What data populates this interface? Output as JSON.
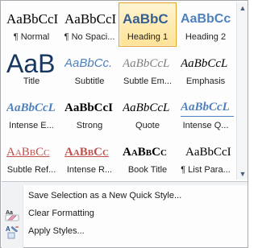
{
  "gallery": {
    "styles": [
      {
        "preview": "AaBbCcI",
        "label": "¶ Normal",
        "selected": false
      },
      {
        "preview": "AaBbCcI",
        "label": "¶ No Spaci...",
        "selected": false
      },
      {
        "preview": "AaBbC",
        "label": "Heading 1",
        "selected": true
      },
      {
        "preview": "AaBbCc",
        "label": "Heading 2",
        "selected": false
      },
      {
        "preview": "AaB",
        "label": "Title",
        "selected": false
      },
      {
        "preview": "AaBbCc.",
        "label": "Subtitle",
        "selected": false
      },
      {
        "preview": "AaBbCcL",
        "label": "Subtle Em...",
        "selected": false
      },
      {
        "preview": "AaBbCcL",
        "label": "Emphasis",
        "selected": false
      },
      {
        "preview": "AaBbCcL",
        "label": "Intense E...",
        "selected": false
      },
      {
        "preview": "AaBbCcI",
        "label": "Strong",
        "selected": false
      },
      {
        "preview": "AaBbCcL",
        "label": "Quote",
        "selected": false
      },
      {
        "preview": "AaBbCcL",
        "label": "Intense Q...",
        "selected": false
      },
      {
        "preview": "AaBbCc",
        "label": "Subtle Ref...",
        "selected": false
      },
      {
        "preview": "AaBbCc",
        "label": "Intense R...",
        "selected": false
      },
      {
        "preview": "AaBbCc",
        "label": "Book Title",
        "selected": false
      },
      {
        "preview": "AaBbCcI",
        "label": "¶ List Para...",
        "selected": false
      }
    ]
  },
  "scrollbar": {
    "up_icon": "▲",
    "down_icon": "▼"
  },
  "menu": {
    "items": [
      {
        "label": "Save Selection as a New Quick Style...",
        "icon": "none"
      },
      {
        "label": "Clear Formatting",
        "icon": "clear-formatting-icon"
      },
      {
        "label": "Apply Styles...",
        "icon": "apply-styles-icon"
      }
    ]
  },
  "colors": {
    "selected_border": "#e3a22b",
    "selected_fill": "#ffe296",
    "heading_blue": "#365f91",
    "accent_blue": "#4f81bd",
    "reference_red": "#c0504d"
  }
}
